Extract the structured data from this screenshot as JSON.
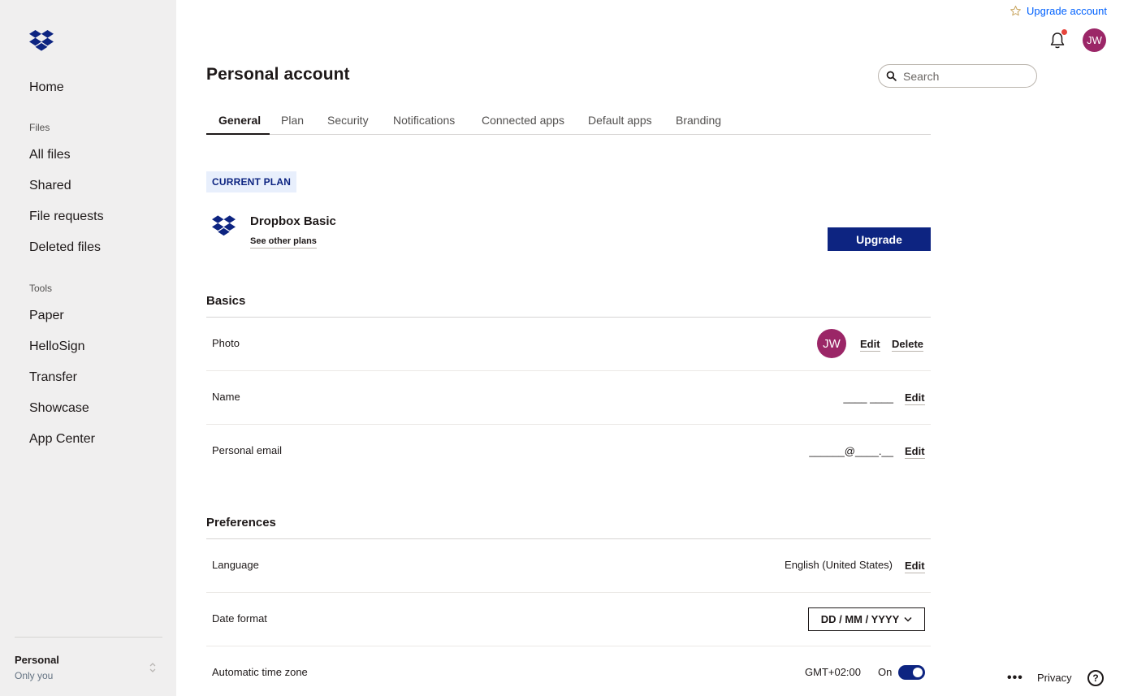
{
  "sidebar": {
    "home": "Home",
    "files_group": "Files",
    "files": [
      "All files",
      "Shared",
      "File requests",
      "Deleted files"
    ],
    "tools_group": "Tools",
    "tools": [
      "Paper",
      "HelloSign",
      "Transfer",
      "Showcase",
      "App Center"
    ],
    "account": {
      "name": "Personal",
      "sub": "Only you"
    }
  },
  "header": {
    "upgrade_link": "Upgrade account",
    "avatar_initials": "JW",
    "search_placeholder": "Search"
  },
  "page": {
    "title": "Personal account",
    "tabs": [
      "General",
      "Plan",
      "Security",
      "Notifications",
      "Connected apps",
      "Default apps",
      "Branding"
    ],
    "active_tab": "General"
  },
  "plan": {
    "badge": "CURRENT PLAN",
    "name": "Dropbox Basic",
    "link": "See other plans",
    "upgrade_button": "Upgrade"
  },
  "basics": {
    "title": "Basics",
    "photo": {
      "label": "Photo",
      "initials": "JW",
      "edit": "Edit",
      "delete": "Delete"
    },
    "name": {
      "label": "Name",
      "value": "____ ____",
      "edit": "Edit"
    },
    "email": {
      "label": "Personal email",
      "value": "______@____.__",
      "edit": "Edit"
    }
  },
  "preferences": {
    "title": "Preferences",
    "language": {
      "label": "Language",
      "value": "English (United States)",
      "edit": "Edit"
    },
    "date_format": {
      "label": "Date format",
      "value": "DD / MM / YYYY"
    },
    "timezone": {
      "label": "Automatic time zone",
      "value": "GMT+02:00",
      "state": "On"
    }
  },
  "footer": {
    "more": "•••",
    "privacy": "Privacy",
    "help": "?"
  },
  "colors": {
    "navy": "#0d2481",
    "accent_blue": "#0061fe",
    "avatar": "#9b2667",
    "notification_dot": "#e6453c"
  }
}
